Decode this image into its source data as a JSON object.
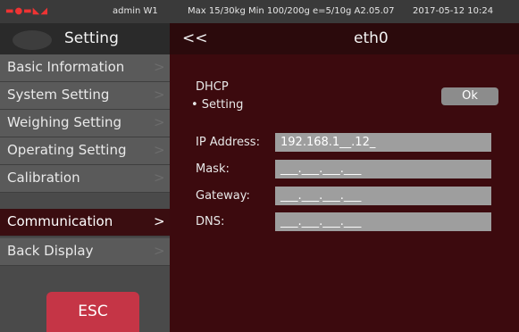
{
  "status_bar": {
    "icons": "signal-indicators",
    "user": "admin  W1",
    "specs": "Max 15/30kg Min 100/200g e=5/10g A2.05.07",
    "datetime": "2017-05-12 10:24"
  },
  "left_panel": {
    "title": "Setting",
    "menu": [
      {
        "label": "Basic Information",
        "arrow": ">"
      },
      {
        "label": "System Setting",
        "arrow": ">"
      },
      {
        "label": "Weighing Setting",
        "arrow": ">"
      },
      {
        "label": "Operating Setting",
        "arrow": ">"
      },
      {
        "label": "Calibration",
        "arrow": ">"
      },
      {
        "label": "Communication",
        "arrow": ">",
        "active": true
      },
      {
        "label": "Back Display",
        "arrow": ">"
      }
    ],
    "esc_label": "ESC"
  },
  "right_panel": {
    "back_label": "<<",
    "interface_name": "eth0",
    "dhcp_label": "DHCP",
    "dhcp_option": "• Setting",
    "ok_label": "Ok",
    "fields": {
      "ip_label": "IP Address:",
      "ip_value": "192.168.1__.12_",
      "mask_label": "Mask:",
      "mask_value": "___.___.___.___",
      "gateway_label": "Gateway:",
      "gateway_value": "___.___.___.___",
      "dns_label": "DNS:",
      "dns_value": "___.___.___.___"
    }
  },
  "colors": {
    "active_menu_bg": "#3a0d10",
    "content_bg": "#3c0a0e",
    "esc_button": "#c53546",
    "menu_bg": "#5a5a5a",
    "field_bg": "#9e9e9e"
  }
}
